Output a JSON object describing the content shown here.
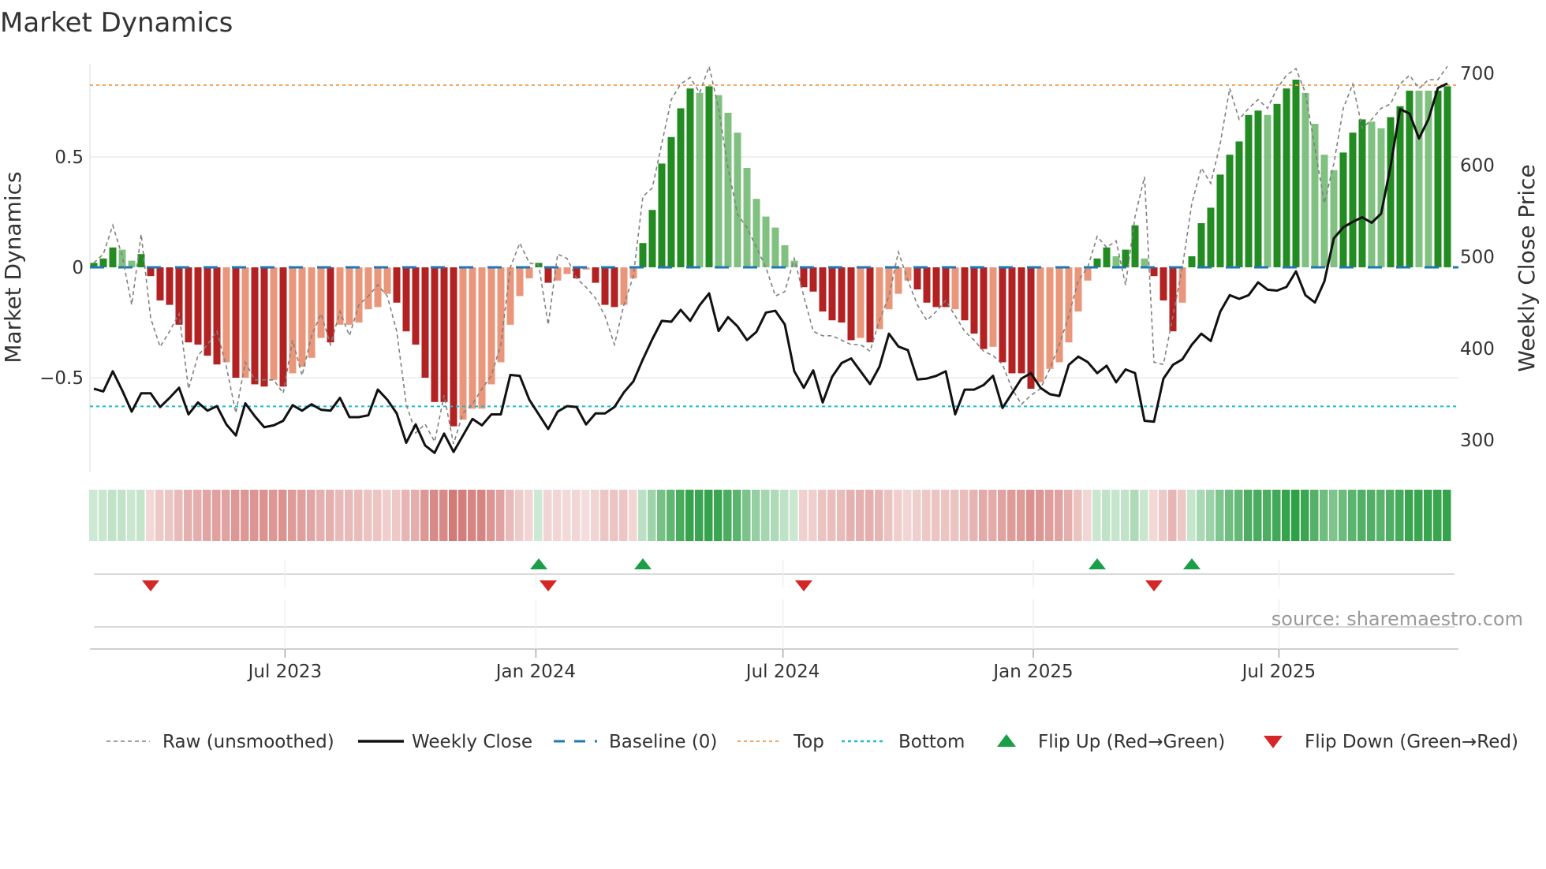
{
  "title": "Market Dynamics",
  "source": "source: sharemaestro.com",
  "colors": {
    "strong_green": "#228b22",
    "weak_green": "#80c080",
    "strong_red": "#b22222",
    "weak_red": "#e9967a",
    "baseline": "#1f77b4",
    "top": "#f4a460",
    "bottom": "#17becf",
    "raw": "#808080",
    "close": "#111111",
    "flip_up": "#1a9e48",
    "flip_down": "#d62728"
  },
  "legend": [
    {
      "label": "Raw (unsmoothed)",
      "style": "dashed-grey"
    },
    {
      "label": "Weekly Close",
      "style": "solid-black"
    },
    {
      "label": "Baseline (0)",
      "style": "dashed-blue"
    },
    {
      "label": "Top",
      "style": "dotted-orange"
    },
    {
      "label": "Bottom",
      "style": "dotted-cyan"
    },
    {
      "label": "Flip Up (Red→Green)",
      "style": "triangle-up-green"
    },
    {
      "label": "Flip Down (Green→Red)",
      "style": "triangle-down-red"
    }
  ],
  "chart_data": {
    "type": "bar",
    "title": "Market Dynamics",
    "ylabel": "Market Dynamics",
    "y2label": "Weekly Close Price",
    "ylim": [
      -0.93,
      0.95
    ],
    "y2lim": [
      280,
      715
    ],
    "yticks": [
      {
        "value": 0.5,
        "label": "0.5"
      },
      {
        "value": 0,
        "label": "0"
      },
      {
        "value": -0.5,
        "label": "−0.5"
      }
    ],
    "y2ticks": [
      {
        "value": 700,
        "label": "700"
      },
      {
        "value": 600,
        "label": "600"
      },
      {
        "value": 500,
        "label": "500"
      },
      {
        "value": 400,
        "label": "400"
      },
      {
        "value": 300,
        "label": "300"
      }
    ],
    "xticks": [
      {
        "label": "Jul 2023",
        "week_index": 20.2
      },
      {
        "label": "Jan 2024",
        "week_index": 46.7
      },
      {
        "label": "Jul 2024",
        "week_index": 72.8
      },
      {
        "label": "Jan 2025",
        "week_index": 99.25
      },
      {
        "label": "Jul 2025",
        "week_index": 125.2
      }
    ],
    "top_level": 0.825,
    "bottom_level": -0.63,
    "baseline": 0,
    "states_legend": "G = strong green, g = weak green, R = strong red, r = weak red",
    "states": "GGGggGRRRRRRRRrRrRRrRrrrrRrrrrrrRRRRRRRrrrrrrrrGRrrRrRRRrrGGGGGGgGgggggggggRRRRRRrRrrrrRRRRrRRRrRRRRrrrrrrGGgGGgRRRrGGGGGGGGgGGGggggGGGggGGGggGG",
    "smoothed": [
      0.02,
      0.04,
      0.09,
      0.08,
      0.03,
      0.06,
      -0.04,
      -0.15,
      -0.17,
      -0.26,
      -0.34,
      -0.35,
      -0.4,
      -0.44,
      -0.43,
      -0.5,
      -0.5,
      -0.53,
      -0.54,
      -0.51,
      -0.54,
      -0.48,
      -0.45,
      -0.41,
      -0.32,
      -0.34,
      -0.26,
      -0.26,
      -0.25,
      -0.19,
      -0.18,
      -0.12,
      -0.16,
      -0.29,
      -0.35,
      -0.5,
      -0.61,
      -0.61,
      -0.72,
      -0.69,
      -0.64,
      -0.64,
      -0.53,
      -0.43,
      -0.26,
      -0.13,
      -0.05,
      0.02,
      -0.07,
      -0.06,
      -0.03,
      -0.05,
      -0.01,
      -0.07,
      -0.17,
      -0.18,
      -0.17,
      -0.05,
      0.11,
      0.26,
      0.47,
      0.59,
      0.72,
      0.81,
      0.79,
      0.82,
      0.78,
      0.7,
      0.61,
      0.45,
      0.31,
      0.23,
      0.18,
      0.1,
      0.03,
      -0.09,
      -0.11,
      -0.2,
      -0.24,
      -0.25,
      -0.33,
      -0.32,
      -0.34,
      -0.28,
      -0.19,
      -0.12,
      -0.06,
      -0.1,
      -0.16,
      -0.18,
      -0.18,
      -0.19,
      -0.24,
      -0.3,
      -0.37,
      -0.36,
      -0.43,
      -0.48,
      -0.48,
      -0.55,
      -0.52,
      -0.46,
      -0.43,
      -0.34,
      -0.2,
      -0.06,
      0.04,
      0.09,
      0.05,
      0.08,
      0.19,
      0.04,
      -0.04,
      -0.15,
      -0.29,
      -0.16,
      0.05,
      0.2,
      0.27,
      0.42,
      0.51,
      0.57,
      0.69,
      0.71,
      0.69,
      0.74,
      0.81,
      0.85,
      0.79,
      0.65,
      0.51,
      0.44,
      0.52,
      0.61,
      0.67,
      0.66,
      0.63,
      0.68,
      0.73,
      0.8,
      0.8,
      0.8,
      0.8,
      0.82
    ],
    "raw": [
      0.02,
      0.06,
      0.19,
      0.05,
      -0.17,
      0.15,
      -0.23,
      -0.36,
      -0.29,
      -0.21,
      -0.55,
      -0.4,
      -0.35,
      -0.29,
      -0.45,
      -0.66,
      -0.43,
      -0.51,
      -0.51,
      -0.51,
      -0.57,
      -0.33,
      -0.49,
      -0.31,
      -0.21,
      -0.35,
      -0.2,
      -0.31,
      -0.17,
      -0.13,
      -0.08,
      -0.13,
      -0.29,
      -0.62,
      -0.75,
      -0.71,
      -0.79,
      -0.58,
      -0.8,
      -0.66,
      -0.62,
      -0.55,
      -0.49,
      -0.35,
      0.0,
      0.11,
      0.02,
      0.01,
      -0.26,
      0.06,
      0.04,
      -0.05,
      -0.09,
      -0.14,
      -0.22,
      -0.35,
      -0.17,
      -0.04,
      0.32,
      0.36,
      0.56,
      0.76,
      0.83,
      0.86,
      0.79,
      0.91,
      0.72,
      0.45,
      0.24,
      0.18,
      0.09,
      0.0,
      -0.13,
      -0.11,
      0.04,
      -0.13,
      -0.29,
      -0.31,
      -0.31,
      -0.33,
      -0.35,
      -0.35,
      -0.38,
      -0.24,
      -0.13,
      0.07,
      -0.06,
      -0.17,
      -0.24,
      -0.2,
      -0.15,
      -0.22,
      -0.29,
      -0.33,
      -0.38,
      -0.4,
      -0.44,
      -0.55,
      -0.62,
      -0.58,
      -0.55,
      -0.46,
      -0.35,
      -0.22,
      -0.06,
      0.0,
      0.14,
      0.09,
      0.12,
      -0.08,
      0.23,
      0.41,
      -0.43,
      -0.44,
      -0.22,
      0.0,
      0.29,
      0.45,
      0.38,
      0.56,
      0.81,
      0.67,
      0.72,
      0.76,
      0.72,
      0.81,
      0.87,
      0.9,
      0.79,
      0.54,
      0.29,
      0.47,
      0.72,
      0.83,
      0.63,
      0.67,
      0.72,
      0.74,
      0.83,
      0.87,
      0.81,
      0.85,
      0.85,
      0.91
    ],
    "weekly_close": [
      356,
      353,
      375,
      354,
      331,
      351,
      351,
      336,
      346,
      357,
      328,
      341,
      332,
      337,
      317,
      305,
      340,
      326,
      314,
      316,
      321,
      338,
      332,
      339,
      333,
      332,
      346,
      325,
      325,
      327,
      355,
      344,
      329,
      297,
      317,
      294,
      286,
      307,
      287,
      305,
      323,
      316,
      328,
      328,
      371,
      370,
      344,
      328,
      312,
      331,
      337,
      336,
      317,
      329,
      329,
      336,
      352,
      364,
      388,
      410,
      430,
      429,
      442,
      430,
      447,
      460,
      419,
      434,
      424,
      409,
      418,
      439,
      441,
      426,
      375,
      357,
      376,
      341,
      369,
      384,
      389,
      375,
      361,
      380,
      416,
      402,
      398,
      366,
      367,
      370,
      375,
      328,
      355,
      355,
      360,
      370,
      335,
      351,
      367,
      373,
      357,
      350,
      348,
      382,
      391,
      385,
      373,
      381,
      363,
      377,
      373,
      321,
      320,
      367,
      382,
      388,
      404,
      416,
      408,
      440,
      458,
      454,
      458,
      472,
      464,
      463,
      467,
      484,
      458,
      450,
      473,
      520,
      532,
      538,
      543,
      537,
      547,
      599,
      661,
      656,
      629,
      650,
      684,
      689
    ],
    "flips_up": [
      47,
      58,
      106,
      116
    ],
    "flips_down": [
      6,
      48,
      75,
      112
    ]
  }
}
